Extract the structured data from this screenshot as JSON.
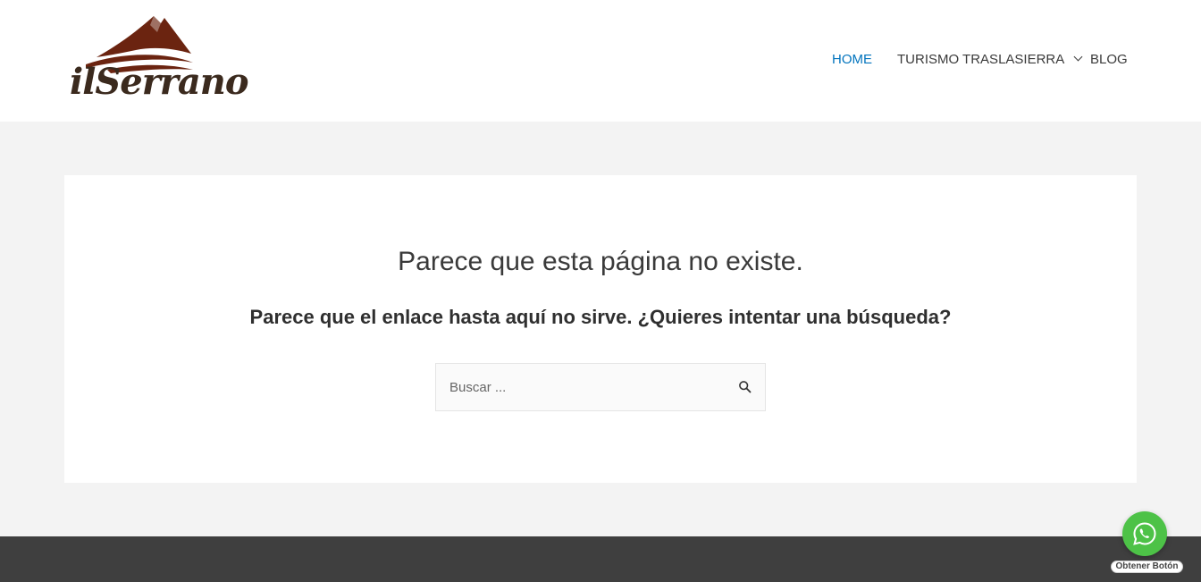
{
  "header": {
    "logo_text": "ilSerrano",
    "nav": [
      {
        "label": "HOME",
        "active": true
      },
      {
        "label": "TURISMO TRASLASIERRA",
        "has_dropdown": true
      },
      {
        "label": "BLOG"
      }
    ]
  },
  "main": {
    "title": "Parece que esta página no existe.",
    "subtitle": "Parece que el enlace hasta aquí no sirve. ¿Quieres intentar una búsqueda?",
    "search": {
      "placeholder": "Buscar ...",
      "value": "",
      "icon": "search-icon"
    }
  },
  "whatsapp": {
    "label": "Obtener Botón",
    "icon": "whatsapp-icon"
  },
  "colors": {
    "accent": "#0274be",
    "logo_brown": "#6b2410",
    "whatsapp_green": "#4dc247",
    "footer": "#3f3f3f",
    "page_bg": "#f3f3f3"
  }
}
